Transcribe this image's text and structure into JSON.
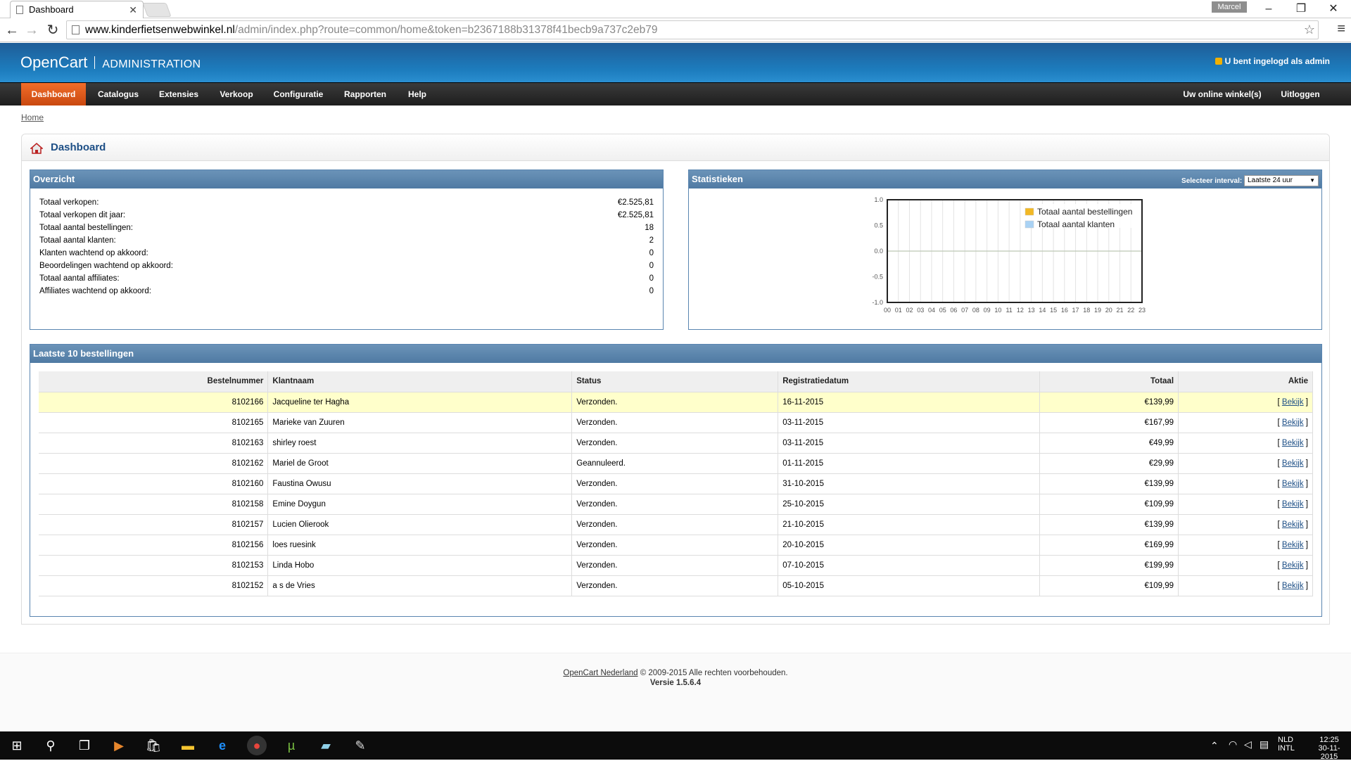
{
  "browser": {
    "tab_title": "Dashboard",
    "tab_close": "✕",
    "user_badge": "Marcel",
    "url_domain": "www.kinderfietsenwebwinkel.nl",
    "url_path": "/admin/index.php?route=common/home&token=b2367188b31378f41becb9a737c2eb79"
  },
  "header": {
    "brand": "OpenCart",
    "subtitle": "ADMINISTRATION",
    "logged_in": "U bent ingelogd als admin"
  },
  "nav": {
    "left": [
      "Dashboard",
      "Catalogus",
      "Extensies",
      "Verkoop",
      "Configuratie",
      "Rapporten",
      "Help"
    ],
    "right": [
      "Uw online winkel(s)",
      "Uitloggen"
    ],
    "active": "Dashboard"
  },
  "breadcrumb": "Home",
  "page_title": "Dashboard",
  "overview": {
    "title": "Overzicht",
    "rows": [
      {
        "label": "Totaal verkopen:",
        "value": "€2.525,81"
      },
      {
        "label": "Totaal verkopen dit jaar:",
        "value": "€2.525,81"
      },
      {
        "label": "Totaal aantal bestellingen:",
        "value": "18"
      },
      {
        "label": "Totaal aantal klanten:",
        "value": "2"
      },
      {
        "label": "Klanten wachtend op akkoord:",
        "value": "0"
      },
      {
        "label": "Beoordelingen wachtend op akkoord:",
        "value": "0"
      },
      {
        "label": "Totaal aantal affiliates:",
        "value": "0"
      },
      {
        "label": "Affiliates wachtend op akkoord:",
        "value": "0"
      }
    ]
  },
  "stats": {
    "title": "Statistieken",
    "interval_label": "Selecteer interval:",
    "interval_value": "Laatste 24 uur"
  },
  "chart_data": {
    "type": "line",
    "title": "",
    "xlabel": "",
    "ylabel": "",
    "x": [
      "00",
      "01",
      "02",
      "03",
      "04",
      "05",
      "06",
      "07",
      "08",
      "09",
      "10",
      "11",
      "12",
      "13",
      "14",
      "15",
      "16",
      "17",
      "18",
      "19",
      "20",
      "21",
      "22",
      "23"
    ],
    "ylim": [
      -1.0,
      1.0
    ],
    "yticks": [
      "1.0",
      "0.5",
      "0.0",
      "-0.5",
      "-1.0"
    ],
    "series": [
      {
        "name": "Totaal aantal bestellingen",
        "color": "#f2b824",
        "values": [
          0,
          0,
          0,
          0,
          0,
          0,
          0,
          0,
          0,
          0,
          0,
          0,
          0,
          0,
          0,
          0,
          0,
          0,
          0,
          0,
          0,
          0,
          0,
          0
        ]
      },
      {
        "name": "Totaal aantal klanten",
        "color": "#a9d2f4",
        "values": [
          0,
          0,
          0,
          0,
          0,
          0,
          0,
          0,
          0,
          0,
          0,
          0,
          0,
          0,
          0,
          0,
          0,
          0,
          0,
          0,
          0,
          0,
          0,
          0
        ]
      }
    ],
    "grid": true,
    "legend": "top-right"
  },
  "orders": {
    "title": "Laatste 10 bestellingen",
    "columns": [
      "Bestelnummer",
      "Klantnaam",
      "Status",
      "Registratiedatum",
      "Totaal",
      "Aktie"
    ],
    "action_label": "Bekijk",
    "rows": [
      {
        "id": "8102166",
        "name": "Jacqueline ter Hagha",
        "status": "Verzonden.",
        "date": "16-11-2015",
        "total": "€139,99"
      },
      {
        "id": "8102165",
        "name": "Marieke van Zuuren",
        "status": "Verzonden.",
        "date": "03-11-2015",
        "total": "€167,99"
      },
      {
        "id": "8102163",
        "name": "shirley roest",
        "status": "Verzonden.",
        "date": "03-11-2015",
        "total": "€49,99"
      },
      {
        "id": "8102162",
        "name": "Mariel de Groot",
        "status": "Geannuleerd.",
        "date": "01-11-2015",
        "total": "€29,99"
      },
      {
        "id": "8102160",
        "name": "Faustina Owusu",
        "status": "Verzonden.",
        "date": "31-10-2015",
        "total": "€139,99"
      },
      {
        "id": "8102158",
        "name": "Emine Doygun",
        "status": "Verzonden.",
        "date": "25-10-2015",
        "total": "€109,99"
      },
      {
        "id": "8102157",
        "name": "Lucien Olierook",
        "status": "Verzonden.",
        "date": "21-10-2015",
        "total": "€139,99"
      },
      {
        "id": "8102156",
        "name": "loes ruesink",
        "status": "Verzonden.",
        "date": "20-10-2015",
        "total": "€169,99"
      },
      {
        "id": "8102153",
        "name": "Linda Hobo",
        "status": "Verzonden.",
        "date": "07-10-2015",
        "total": "€199,99"
      },
      {
        "id": "8102152",
        "name": "a s de Vries",
        "status": "Verzonden.",
        "date": "05-10-2015",
        "total": "€109,99"
      }
    ]
  },
  "footer": {
    "link": "OpenCart Nederland",
    "rights": " © 2009-2015 Alle rechten voorbehouden.",
    "version": "Versie 1.5.6.4"
  },
  "taskbar": {
    "lang1": "NLD",
    "lang2": "INTL",
    "time": "12:25",
    "date": "30-11-2015"
  }
}
